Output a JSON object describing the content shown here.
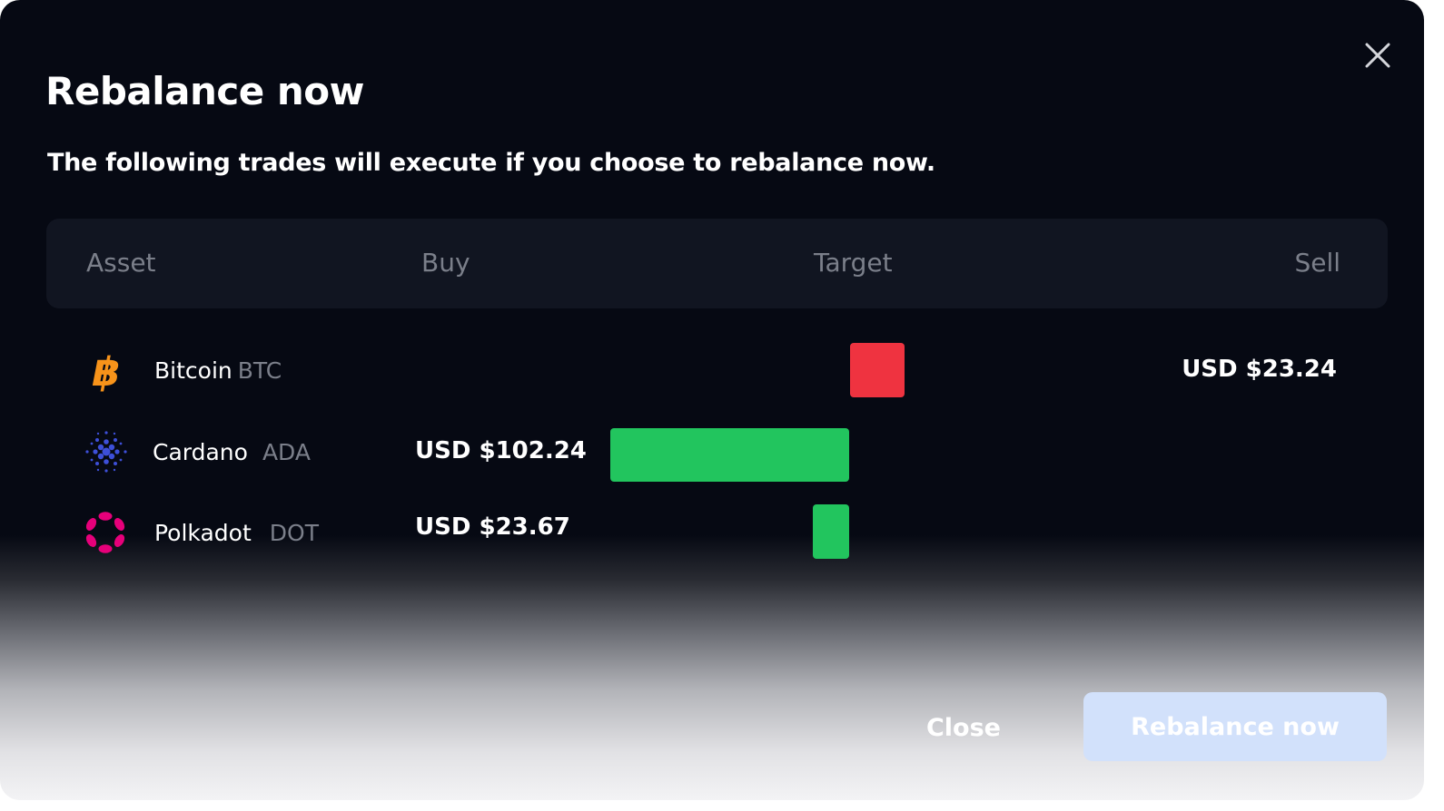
{
  "dialog": {
    "title": "Rebalance now",
    "subtitle": "The following trades will execute if you choose to rebalance now."
  },
  "table": {
    "columns": {
      "asset": "Asset",
      "buy": "Buy",
      "target": "Target",
      "sell": "Sell"
    },
    "rows": [
      {
        "name": "Bitcoin",
        "ticker": "BTC",
        "icon": "bitcoin-icon",
        "buy": "",
        "sell": "USD $23.24",
        "direction": "sell"
      },
      {
        "name": "Cardano",
        "ticker": "ADA",
        "icon": "cardano-icon",
        "buy": "USD $102.24",
        "sell": "",
        "direction": "buy"
      },
      {
        "name": "Polkadot",
        "ticker": "DOT",
        "icon": "polkadot-icon",
        "buy": "USD $23.67",
        "sell": "",
        "direction": "buy"
      }
    ]
  },
  "footer": {
    "close_label": "Close",
    "primary_label": "Rebalance now"
  },
  "colors": {
    "sell": "#ef3340",
    "buy": "#22c55e",
    "bitcoin": "#f7931a",
    "cardano": "#3d4fd8",
    "polkadot": "#e6007a",
    "primary_button": "#d2e1fb"
  }
}
